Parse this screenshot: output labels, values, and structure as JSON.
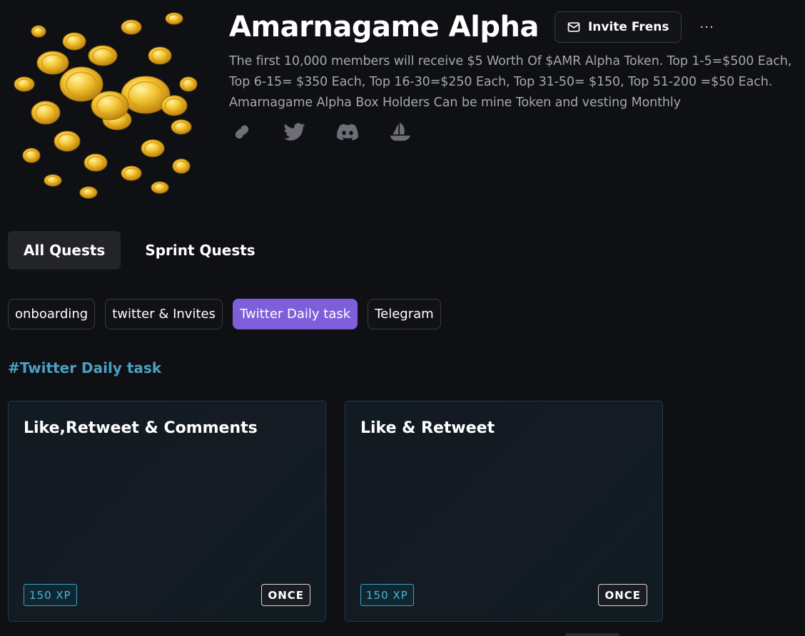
{
  "header": {
    "title": "Amarnagame Alpha",
    "invite_label": "Invite Frens",
    "more_label": "···",
    "description": "The first 10,000 members will receive $5 Worth Of $AMR Alpha Token. Top 1-5=$500 Each, Top 6-15= $350 Each, Top 16-30=$250 Each, Top 31-50= $150, Top 51-200 =$50 Each. Amarnagame Alpha Box Holders Can be mine Token and vesting Monthly",
    "social_icons": [
      "link-icon",
      "twitter-icon",
      "discord-icon",
      "opensea-icon"
    ]
  },
  "tabs": [
    {
      "label": "All Quests",
      "active": true
    },
    {
      "label": "Sprint Quests",
      "active": false
    }
  ],
  "chips": [
    {
      "label": "onboarding",
      "active": false
    },
    {
      "label": "twitter & Invites",
      "active": false
    },
    {
      "label": "Twitter Daily task",
      "active": true
    },
    {
      "label": "Telegram",
      "active": false
    }
  ],
  "section": {
    "title": "#Twitter Daily task"
  },
  "cards": [
    {
      "title": "Like,Retweet & Comments",
      "xp": "150 XP",
      "frequency": "ONCE"
    },
    {
      "title": "Like & Retweet",
      "xp": "150 XP",
      "frequency": "ONCE"
    }
  ],
  "colors": {
    "background": "#0f1014",
    "accent_purple": "#7e5fd9",
    "section_blue": "#4aa0c4",
    "xp_blue": "#4fb3d9",
    "coin_gold": "#f2c230"
  }
}
